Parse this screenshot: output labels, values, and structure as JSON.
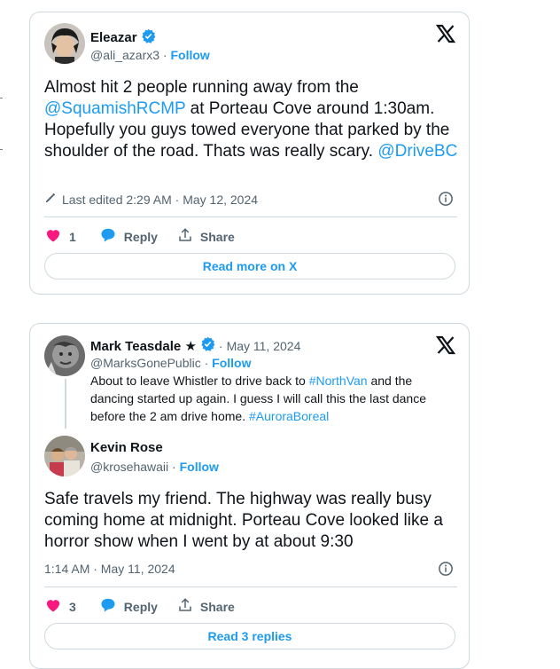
{
  "colors": {
    "accent": "#1d9bf0",
    "like": "#f91880",
    "muted": "#536471",
    "border": "#cfd9de"
  },
  "tweet1": {
    "author_name": "Eleazar",
    "handle": "@ali_azarx3",
    "separator": "·",
    "follow_label": "Follow",
    "text_parts": {
      "p1": "Almost hit 2 people running away from the ",
      "mention1": "@SquamishRCMP",
      "p2": " at Porteau Cove around 1:30am. Hopefully you guys towed everyone that parked by the shoulder of the road. Thats was really scary. ",
      "mention2": "@DriveBC"
    },
    "meta": "Last edited 2:29 AM · May 12, 2024",
    "likes": "1",
    "reply_label": "Reply",
    "share_label": "Share",
    "more_label": "Read more on X",
    "icons": [
      "verified-badge-icon",
      "x-logo-icon",
      "pencil-icon",
      "info-icon",
      "heart-icon",
      "reply-icon",
      "share-icon"
    ]
  },
  "tweet2": {
    "quoted": {
      "author_name": "Mark Teasdale ★",
      "date": "May 11, 2024",
      "handle": "@MarksGonePublic",
      "separator": "·",
      "follow_label": "Follow",
      "text_parts": {
        "p1": "About to leave Whistler to drive back to ",
        "tag1": "#NorthVan",
        "p2": " and the dancing started up again. I guess I will call this the last dance before the 2 am drive home. ",
        "tag2": "#AuroraBoreal"
      }
    },
    "reply": {
      "author_name": "Kevin Rose",
      "handle": "@krosehawaii",
      "separator": "·",
      "follow_label": "Follow",
      "text": "Safe travels my friend. The highway was really busy coming home at midnight. Porteau Cove looked like a horror show when I went by at about 9:30",
      "meta": "1:14 AM · May 11, 2024"
    },
    "likes": "3",
    "reply_label": "Reply",
    "share_label": "Share",
    "more_label": "Read 3 replies"
  }
}
